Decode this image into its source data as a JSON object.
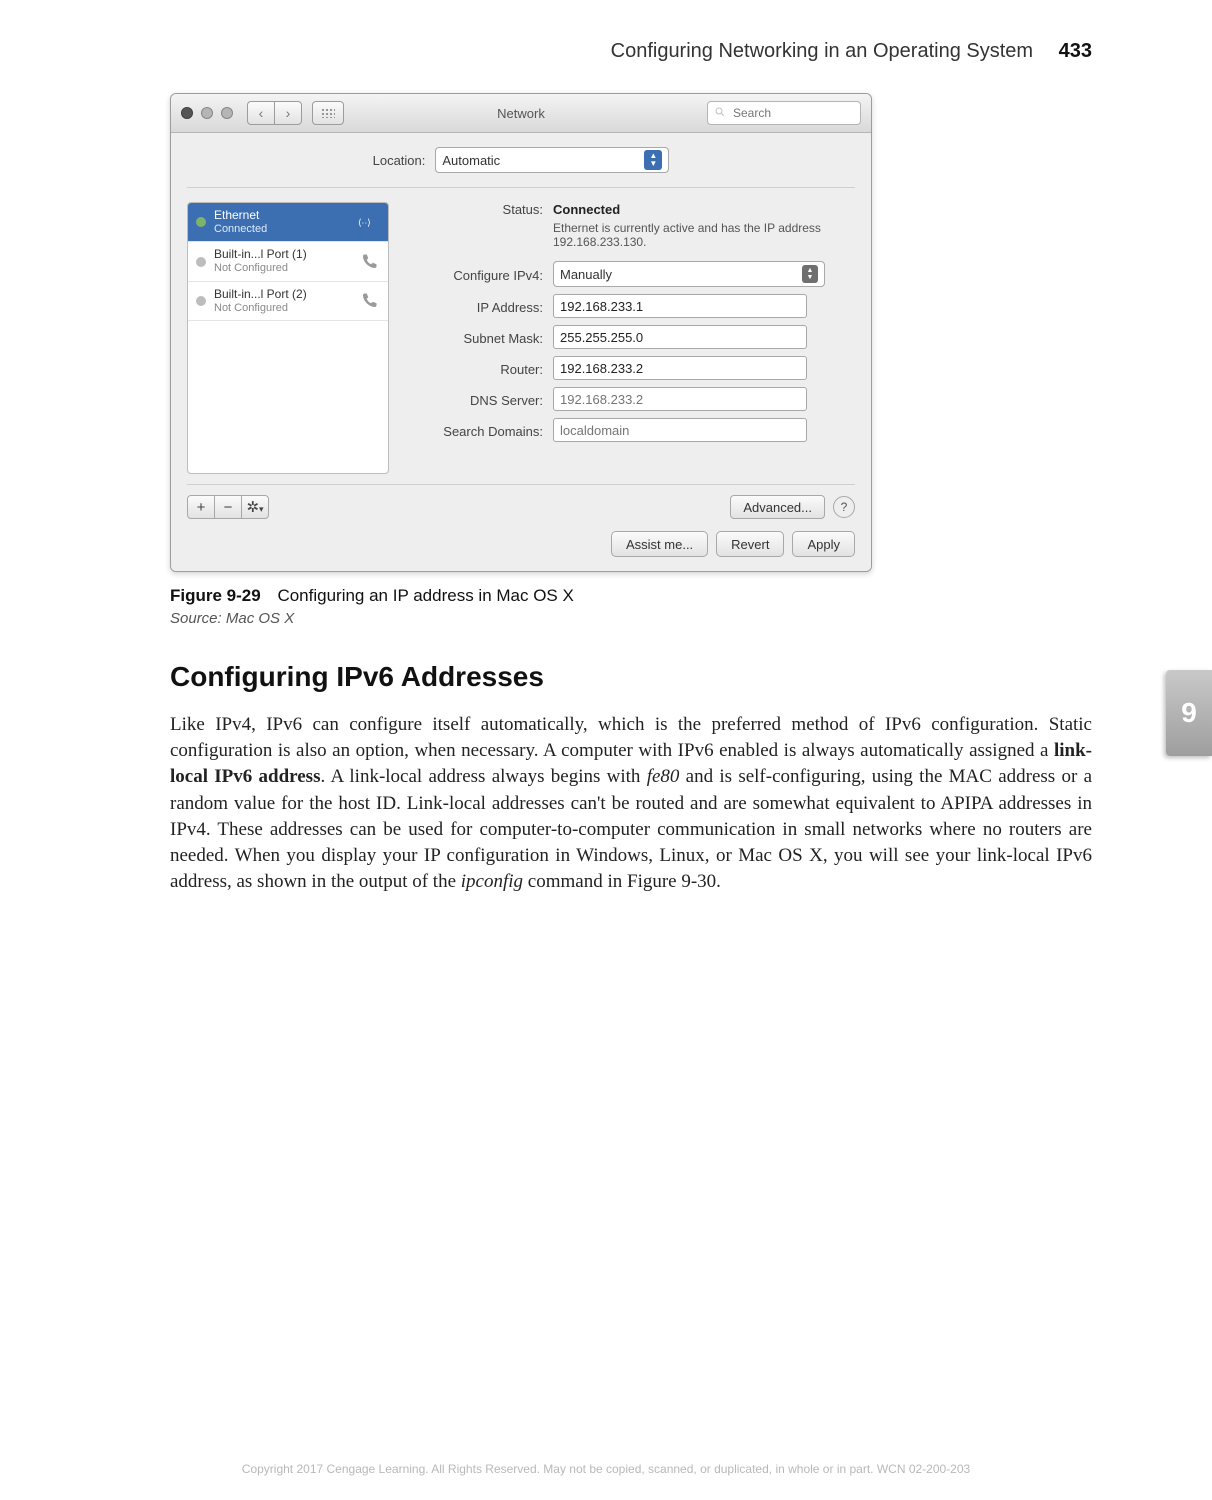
{
  "header": {
    "running_title": "Configuring Networking in an Operating System",
    "page_number": "433"
  },
  "side_tab": {
    "label": "9"
  },
  "mac_window": {
    "title": "Network",
    "search_placeholder": "Search",
    "location_label": "Location:",
    "location_value": "Automatic",
    "sidebar": {
      "items": [
        {
          "name": "Ethernet",
          "status": "Connected",
          "icon": "ethernet"
        },
        {
          "name": "Built-in...l Port (1)",
          "status": "Not Configured",
          "icon": "phone"
        },
        {
          "name": "Built-in...l Port (2)",
          "status": "Not Configured",
          "icon": "phone"
        }
      ]
    },
    "details": {
      "status_label": "Status:",
      "status_value": "Connected",
      "status_sub": "Ethernet is currently active and has the IP address 192.168.233.130.",
      "configure_label": "Configure IPv4:",
      "configure_value": "Manually",
      "ip_label": "IP Address:",
      "ip_value": "192.168.233.1",
      "subnet_label": "Subnet Mask:",
      "subnet_value": "255.255.255.0",
      "router_label": "Router:",
      "router_value": "192.168.233.2",
      "dns_label": "DNS Server:",
      "dns_placeholder": "192.168.233.2",
      "search_label": "Search Domains:",
      "search_placeholder": "localdomain"
    },
    "buttons": {
      "advanced": "Advanced...",
      "assist": "Assist me...",
      "revert": "Revert",
      "apply": "Apply"
    }
  },
  "figure": {
    "label": "Figure 9-29",
    "caption": "Configuring an IP address in Mac OS X",
    "source": "Source: Mac OS X"
  },
  "section": {
    "heading": "Configuring IPv6 Addresses",
    "para_a": "Like IPv4, IPv6 can configure itself automatically, which is the preferred method of IPv6 configuration. Static configuration is also an option, when necessary. A computer with IPv6 enabled is always automatically assigned a ",
    "term_bold": "link-local IPv6 address",
    "para_b": ". A link-local address always begins with ",
    "term_ital": "fe80",
    "para_c": " and is self-configuring, using the MAC address or a random value for the host ID. Link-local addresses can't be routed and are somewhat equivalent to APIPA addresses in IPv4. These addresses can be used for computer-to-computer communication in small networks where no routers are needed. When you display your IP configuration in Windows, Linux, or Mac OS X, you will see your link-local IPv6 address, as shown in the output of the ",
    "term_ital2": "ipconfig",
    "para_d": " command in Figure 9-30."
  },
  "copyright": "Copyright 2017 Cengage Learning. All Rights Reserved. May not be copied, scanned, or duplicated, in whole or in part.  WCN 02-200-203"
}
